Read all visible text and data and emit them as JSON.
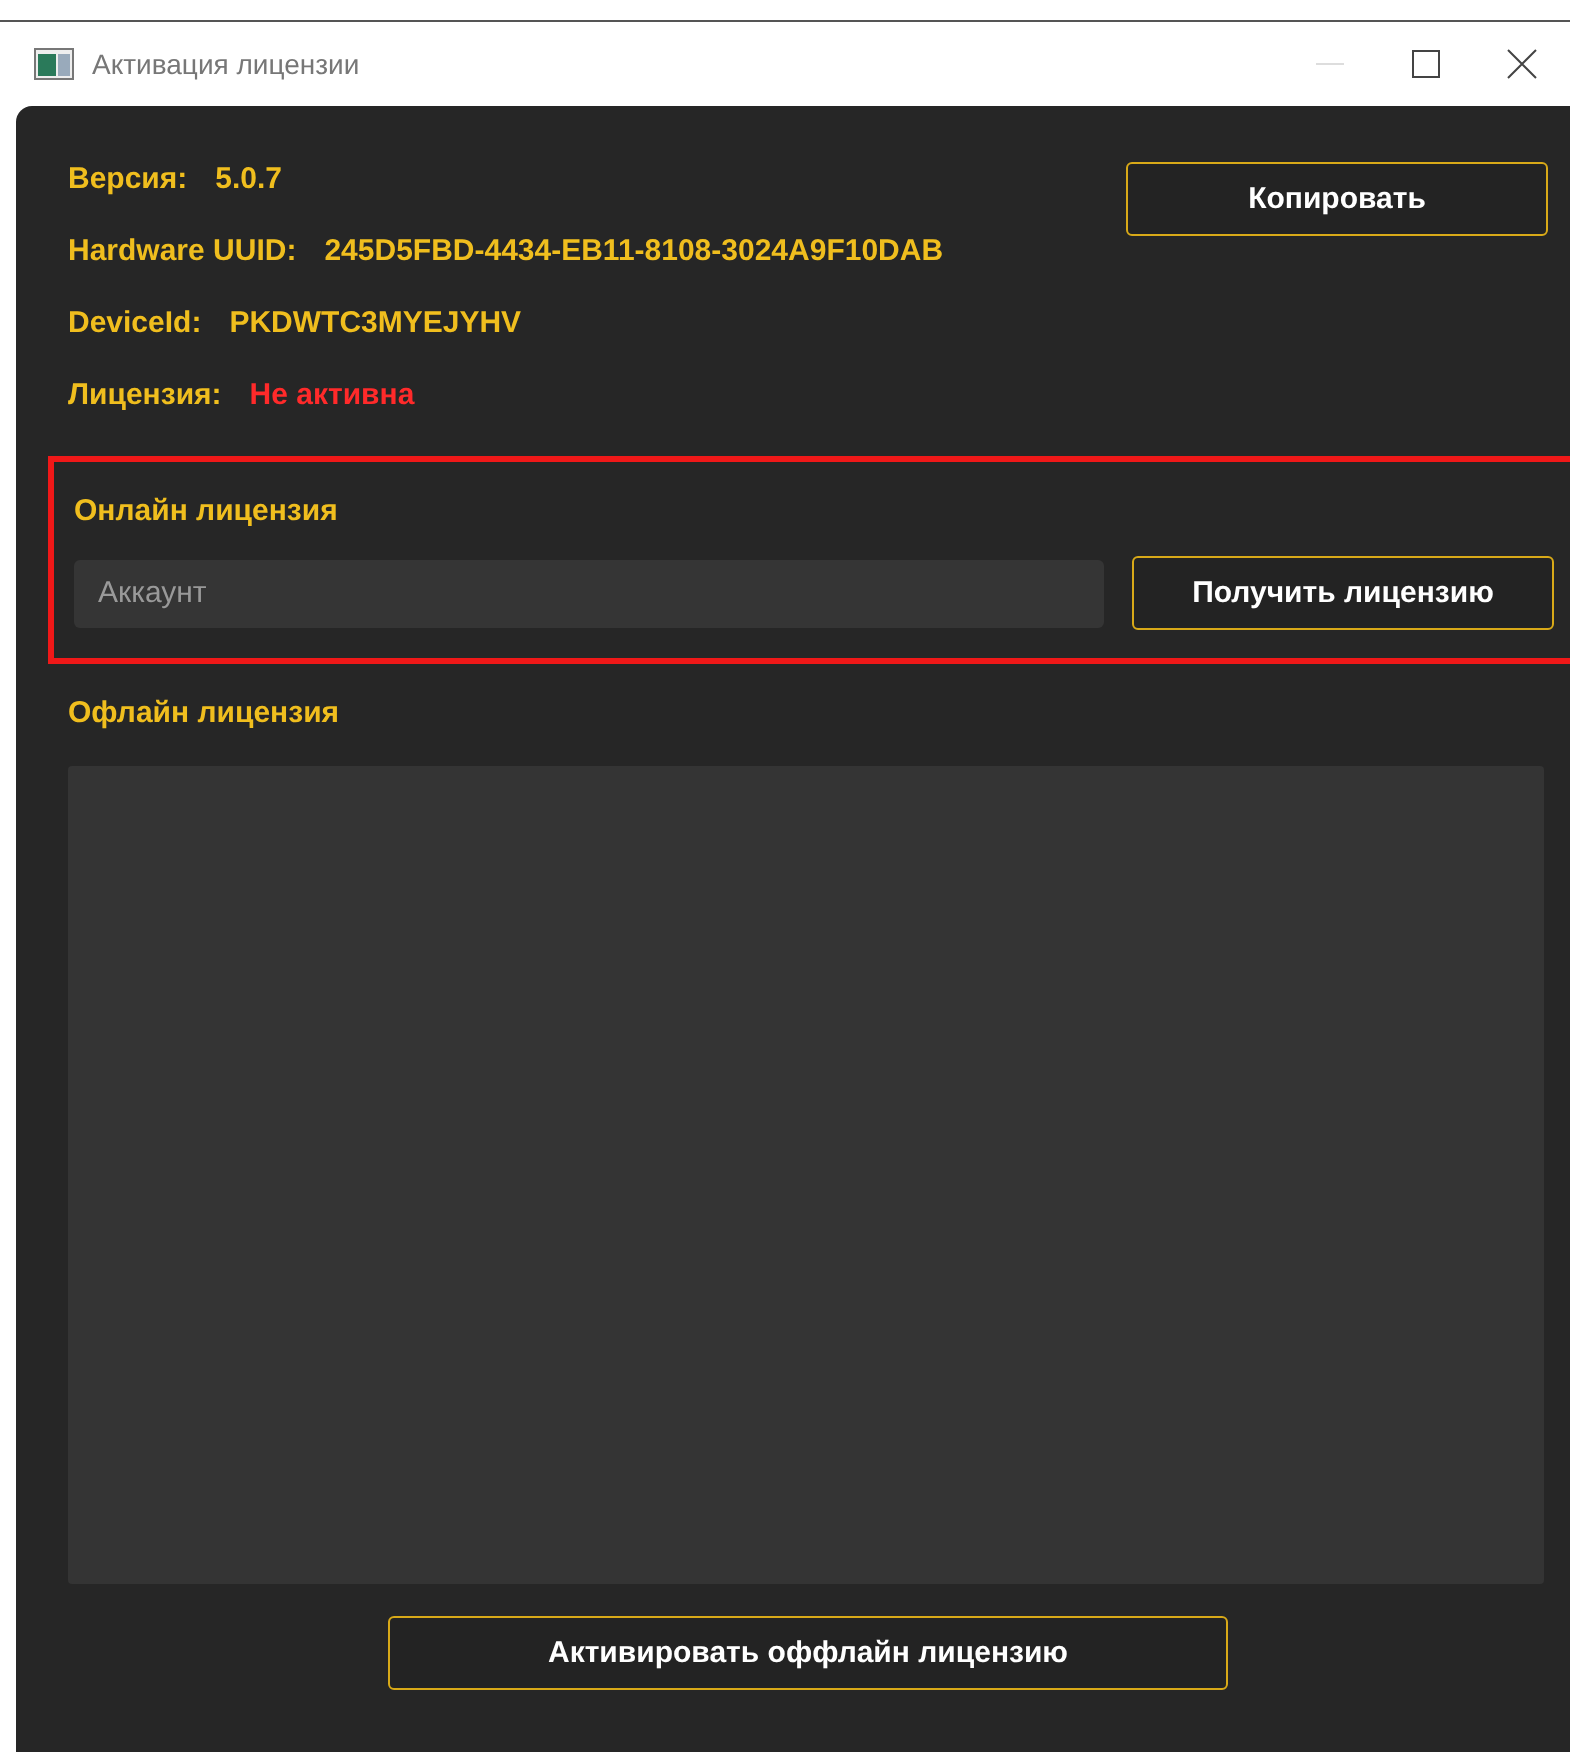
{
  "window": {
    "title": "Активация лицензии"
  },
  "info": [
    {
      "label": "Версия:",
      "value": "5.0.7"
    },
    {
      "label": "Hardware UUID:",
      "value": "245D5FBD-4434-EB11-8108-3024A9F10DAB"
    },
    {
      "label": "DeviceId:",
      "value": "PKDWTC3MYEJYHV"
    }
  ],
  "license": {
    "label": "Лицензия:",
    "value": "Не активна",
    "active": false
  },
  "copy_button": "Копировать",
  "online": {
    "title": "Онлайн лицензия",
    "account": {
      "placeholder": "Аккаунт"
    },
    "button": "Получить лицензию",
    "highlighted": true
  },
  "offline": {
    "title": "Офлайн лицензия",
    "button": "Активировать оффлайн лицензию"
  }
}
